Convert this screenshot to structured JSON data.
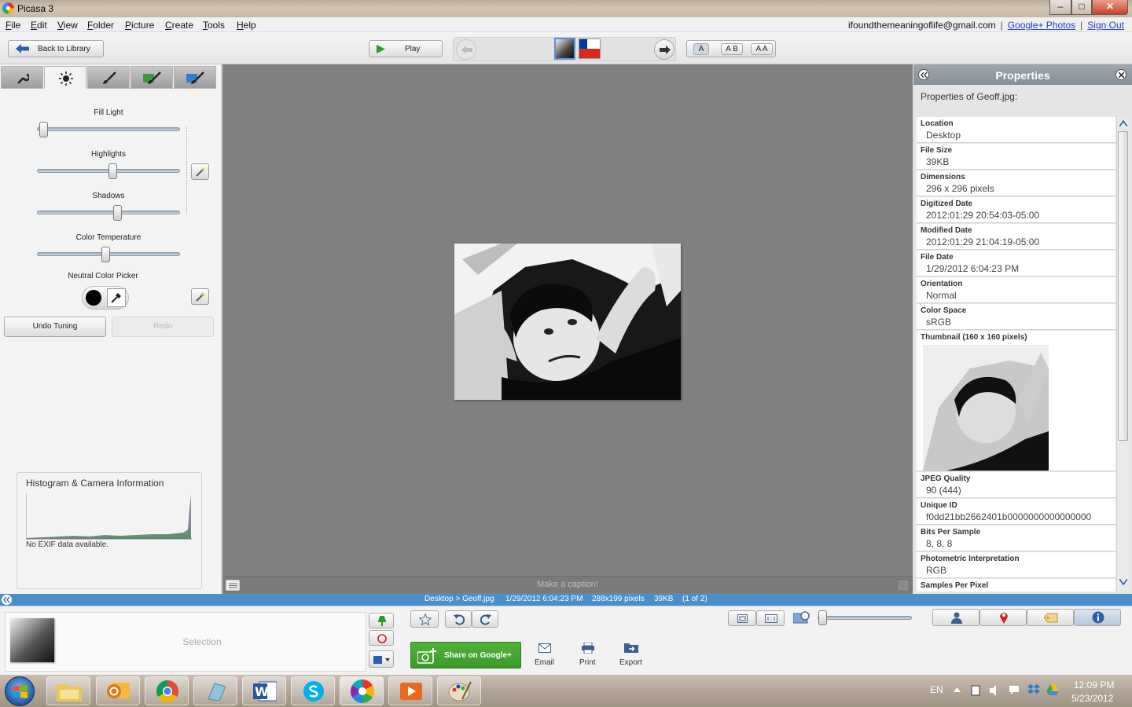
{
  "window": {
    "title": "Picasa 3",
    "minimize": "–",
    "maximize": "□",
    "close": "✕"
  },
  "menu": [
    "File",
    "Edit",
    "View",
    "Folder",
    "Picture",
    "Create",
    "Tools",
    "Help"
  ],
  "account": {
    "email": "ifoundthemeaningoflife@gmail.com",
    "google_photos": "Google+ Photos",
    "sign_out": "Sign Out"
  },
  "toolbar": {
    "back_label": "Back to Library",
    "play_label": "Play",
    "view_a": "A",
    "view_ab": "A B",
    "view_aa": "A A"
  },
  "tuning": {
    "fill_light": "Fill Light",
    "highlights": "Highlights",
    "shadows": "Shadows",
    "color_temperature": "Color Temperature",
    "neutral_color_picker": "Neutral Color Picker",
    "undo_label": "Undo Tuning",
    "redo_label": "Redo",
    "levels": {
      "fill_light": 0.02,
      "highlights": 0.53,
      "shadows": 0.57,
      "color_temperature": 0.48
    }
  },
  "histogram": {
    "title": "Histogram & Camera Information",
    "note": "No EXIF data available."
  },
  "caption": {
    "placeholder": "Make a caption!"
  },
  "properties": {
    "header": "Properties",
    "title": "Properties of Geoff.jpg:",
    "thumbnail_label": "Thumbnail (160 x 160 pixels)",
    "items": [
      {
        "key": "Location",
        "value": "Desktop"
      },
      {
        "key": "File Size",
        "value": "39KB"
      },
      {
        "key": "Dimensions",
        "value": "296 x 296 pixels"
      },
      {
        "key": "Digitized Date",
        "value": "2012:01:29 20:54:03-05:00"
      },
      {
        "key": "Modified Date",
        "value": "2012:01:29 21:04:19-05:00"
      },
      {
        "key": "File Date",
        "value": "1/29/2012 6:04:23 PM"
      },
      {
        "key": "Orientation",
        "value": "Normal"
      },
      {
        "key": "Color Space",
        "value": "sRGB"
      }
    ],
    "items_after": [
      {
        "key": "JPEG Quality",
        "value": "90 (444)"
      },
      {
        "key": "Unique ID",
        "value": "f0dd21bb2662401b0000000000000000"
      },
      {
        "key": "Bits Per Sample",
        "value": "8, 8, 8"
      },
      {
        "key": "Photometric Interpretation",
        "value": "RGB"
      },
      {
        "key": "Samples Per Pixel",
        "value": ""
      }
    ]
  },
  "status": {
    "path": "Desktop > Geoff.jpg",
    "date": "1/29/2012 6:04:23 PM",
    "size_px": "288x199 pixels",
    "size_kb": "39KB",
    "count": "(1 of 2)"
  },
  "tray": {
    "selection_label": "Selection",
    "share_label": "Share on Google+",
    "email_label": "Email",
    "print_label": "Print",
    "export_label": "Export"
  },
  "taskbar": {
    "lang": "EN",
    "time": "12:09 PM",
    "date": "5/23/2012"
  },
  "colors": {
    "status_blue": "#4a8fc9",
    "share_green": "#3d9a2a",
    "main_gray": "#808080"
  }
}
